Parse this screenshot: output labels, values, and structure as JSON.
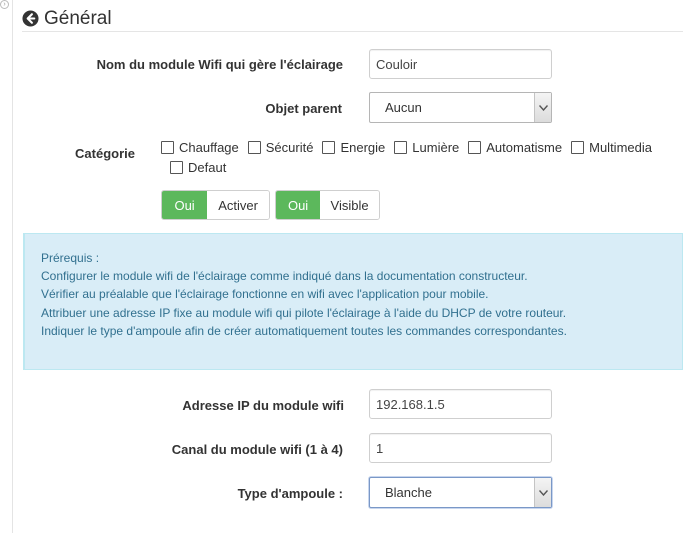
{
  "section": {
    "title": "Général"
  },
  "fields": {
    "module_name": {
      "label": "Nom du module Wifi qui gère l'éclairage",
      "value": "Couloir"
    },
    "parent": {
      "label": "Objet parent",
      "value": "Aucun"
    },
    "category": {
      "label": "Catégorie",
      "options": [
        "Chauffage",
        "Sécurité",
        "Energie",
        "Lumière",
        "Automatisme",
        "Multimedia",
        "Defaut"
      ]
    },
    "activate": {
      "on_label": "Oui",
      "label": "Activer"
    },
    "visible": {
      "on_label": "Oui",
      "label": "Visible"
    },
    "ip": {
      "label": "Adresse IP du module wifi",
      "value": "192.168.1.5"
    },
    "channel": {
      "label": "Canal du module wifi (1 à 4)",
      "value": "1"
    },
    "bulb_type": {
      "label": "Type d'ampoule :",
      "value": "Blanche"
    }
  },
  "info": {
    "lines": [
      "Prérequis :",
      "Configurer le module wifi de l'éclairage comme indiqué dans la documentation constructeur.",
      "Vérifier au préalable que l'éclairage fonctionne en wifi avec l'application pour mobile.",
      "Attribuer une adresse IP fixe au module wifi qui pilote l'éclairage à l'aide du DHCP de votre routeur.",
      "Indiquer le type d'ampoule afin de créer automatiquement toutes les commandes correspondantes."
    ]
  },
  "icons": {
    "back": "circle-arrow-left-icon",
    "select_arrow": "chevron-down-icon"
  }
}
